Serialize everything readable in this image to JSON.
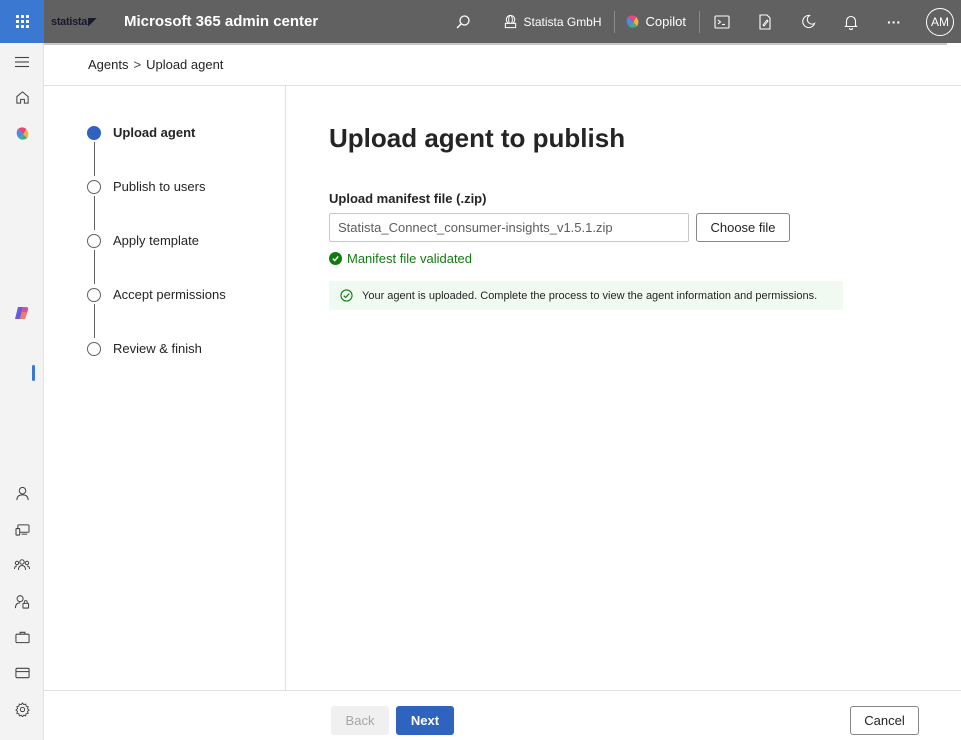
{
  "header": {
    "logo_text": "statista",
    "app_title": "Microsoft 365 admin center",
    "org_name": "Statista GmbH",
    "copilot_label": "Copilot",
    "avatar_initials": "AM",
    "more_label": "···",
    "colors": {
      "bar": "#616161",
      "waffle": "#3a78d1"
    }
  },
  "rail": {
    "icons": [
      "menu-icon",
      "home-icon",
      "copilot-icon",
      "copilot-app-icon",
      "user-icon",
      "devices-icon",
      "teams-icon",
      "roles-icon",
      "resources-icon",
      "billing-icon",
      "settings-icon"
    ]
  },
  "breadcrumb": {
    "items": [
      "Agents",
      "Upload agent"
    ],
    "separator": ">"
  },
  "steps": [
    {
      "label": "Upload agent",
      "state": "current"
    },
    {
      "label": "Publish to users",
      "state": "pending"
    },
    {
      "label": "Apply template",
      "state": "pending"
    },
    {
      "label": "Accept permissions",
      "state": "pending"
    },
    {
      "label": "Review & finish",
      "state": "pending"
    }
  ],
  "main": {
    "title": "Upload agent to publish",
    "field_label": "Upload manifest file (.zip)",
    "file_value": "Statista_Connect_consumer-insights_v1.5.1.zip",
    "choose_button": "Choose file",
    "validation_text": "Manifest file validated",
    "banner_text": "Your agent is uploaded. Complete the process to view the agent information and permissions.",
    "colors": {
      "success": "#107c10",
      "banner_bg": "#f1faf1",
      "primary": "#2f63c0"
    }
  },
  "footer": {
    "back_label": "Back",
    "next_label": "Next",
    "cancel_label": "Cancel"
  }
}
